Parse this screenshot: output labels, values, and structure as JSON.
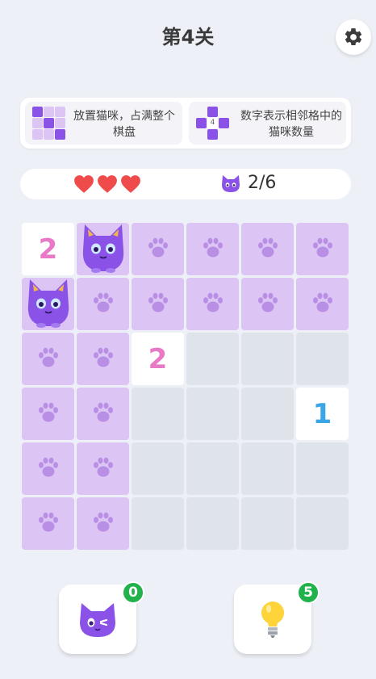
{
  "level_title": "第4关",
  "hints": [
    {
      "text": "放置猫咪，占满整个棋盘"
    },
    {
      "text": "数字表示相邻格中的猫咪数量",
      "mini_number": "4"
    }
  ],
  "lives": 3,
  "cats_progress": "2/6",
  "board": {
    "rows": 6,
    "cols": 6,
    "cells": [
      [
        "number",
        "cat",
        "unknown",
        "unknown",
        "unknown",
        "unknown"
      ],
      [
        "cat",
        "unknown",
        "unknown",
        "unknown",
        "unknown",
        "unknown"
      ],
      [
        "unknown",
        "unknown",
        "number",
        "empty",
        "empty",
        "empty"
      ],
      [
        "unknown",
        "unknown",
        "empty",
        "empty",
        "empty",
        "number"
      ],
      [
        "unknown",
        "unknown",
        "empty",
        "empty",
        "empty",
        "empty"
      ],
      [
        "unknown",
        "unknown",
        "empty",
        "empty",
        "empty",
        "empty"
      ]
    ],
    "numbers": [
      {
        "row": 0,
        "col": 0,
        "value": "2",
        "color": "#e879c6"
      },
      {
        "row": 2,
        "col": 2,
        "value": "2",
        "color": "#e879c6"
      },
      {
        "row": 3,
        "col": 5,
        "value": "1",
        "color": "#3aa6e8"
      }
    ]
  },
  "tools": {
    "cat_count": "0",
    "hint_count": "5"
  },
  "colors": {
    "unknown_cell": "#dcc5f5",
    "empty_cell": "#dfe3ea",
    "heart": "#ef4b4b",
    "badge": "#22b24c",
    "cat": "#8b52e8"
  },
  "icons": {
    "settings": "gear-icon",
    "paw": "paw-icon",
    "heart": "heart-icon",
    "cat": "cat-face-icon",
    "bulb": "lightbulb-icon"
  }
}
